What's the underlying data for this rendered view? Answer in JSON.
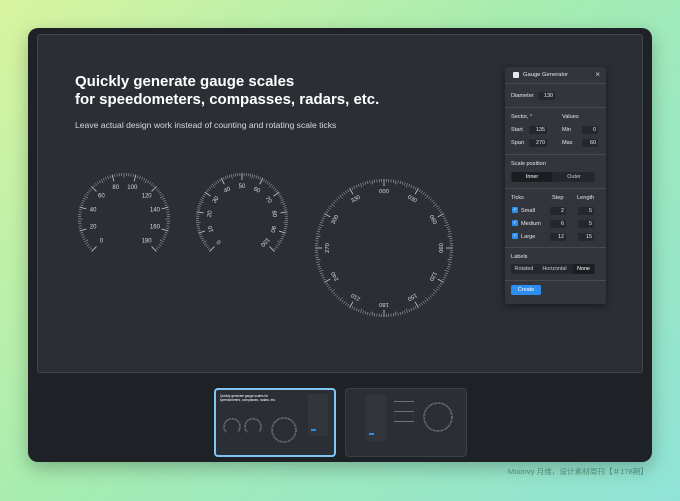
{
  "hero": {
    "title_line1": "Quickly generate gauge scales",
    "title_line2": "for speedometers, compasses, radars, etc.",
    "subtitle": "Leave actual design work instead of counting and rotating scale ticks"
  },
  "gauges": {
    "speedometer": {
      "labels": [
        "0",
        "20",
        "40",
        "60",
        "80",
        "100",
        "120",
        "140",
        "160",
        "180"
      ]
    },
    "mid_gauge": {
      "labels": [
        "0",
        "10",
        "20",
        "30",
        "40",
        "50",
        "60",
        "70",
        "80",
        "90",
        "100"
      ]
    },
    "compass": {
      "labels": [
        "000",
        "030",
        "060",
        "090",
        "120",
        "150",
        "180",
        "210",
        "240",
        "270",
        "300",
        "330"
      ]
    }
  },
  "panel": {
    "title": "Gauge Generator",
    "close_glyph": "×",
    "diameter_label": "Diameter",
    "diameter_value": "130",
    "sector_label": "Sector, °",
    "values_label": "Values",
    "start_label": "Start",
    "start_value": "135",
    "span_label": "Span",
    "span_value": "270",
    "min_label": "Min",
    "min_value": "0",
    "max_label": "Max",
    "max_value": "60",
    "scale_position_label": "Scale position",
    "scale_options": [
      "Inner",
      "Outer"
    ],
    "scale_selected": "Inner",
    "ticks_label": "Ticks",
    "step_label": "Step",
    "length_label": "Length",
    "ticks": [
      {
        "name": "Small",
        "step": "2",
        "length": "5",
        "checked": true
      },
      {
        "name": "Medium",
        "step": "6",
        "length": "5",
        "checked": true
      },
      {
        "name": "Large",
        "step": "12",
        "length": "15",
        "checked": true
      }
    ],
    "labels_label": "Labels",
    "label_options": [
      "Rotated",
      "Horizontal",
      "None"
    ],
    "label_selected": "None",
    "create_label": "Create"
  },
  "thumbnails": {
    "thumb1_title": "Quickly generate gauge scales for speedometers, compasses, radars, etc."
  },
  "credit": "Moonvy 月维，设计素材周刊【＃178期】",
  "colors": {
    "accent": "#2e8ef0",
    "thumb_selected_border": "#80c6f2",
    "background": "#2b2f35"
  }
}
